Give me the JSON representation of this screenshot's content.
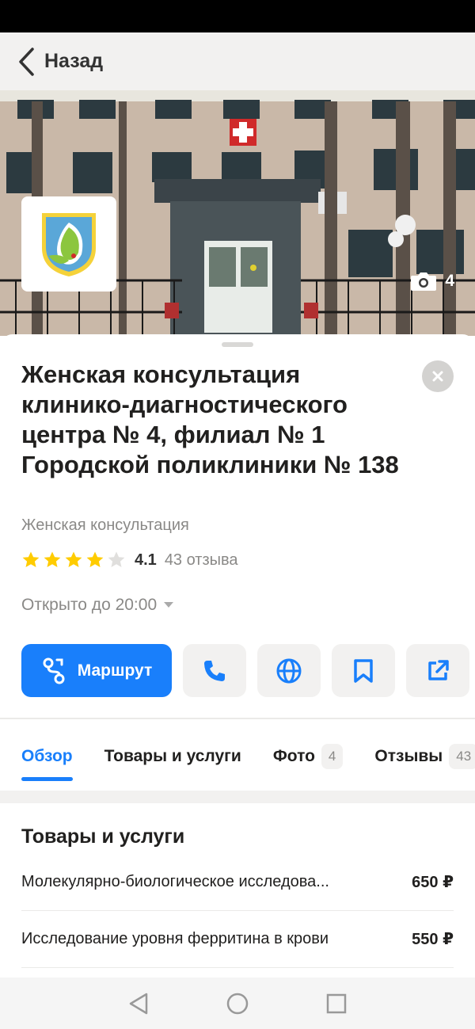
{
  "nav": {
    "back_label": "Назад"
  },
  "hero": {
    "photo_count": "4"
  },
  "organization": {
    "title": "Женская консультация клинико-диагностического центра № 4, филиал № 1 Городской поликлиники № 138",
    "category": "Женская консультация",
    "rating": 4.1,
    "rating_text": "4.1",
    "reviews_text": "43 отзыва",
    "hours_text": "Открыто до 20:00"
  },
  "actions": {
    "route_label": "Маршрут",
    "icons": [
      "phone-icon",
      "globe-icon",
      "bookmark-icon",
      "share-icon"
    ]
  },
  "tabs": [
    {
      "label": "Обзор",
      "active": true
    },
    {
      "label": "Товары и услуги"
    },
    {
      "label": "Фото",
      "badge": "4"
    },
    {
      "label": "Отзывы",
      "badge": "43"
    }
  ],
  "services": {
    "title": "Товары и услуги",
    "items": [
      {
        "name": "Молекулярно-биологическое исследова...",
        "price": "650 ₽"
      },
      {
        "name": "Исследование уровня ферритина в крови",
        "price": "550 ₽"
      }
    ]
  },
  "colors": {
    "accent": "#197ffb",
    "star": "#ffcc00",
    "muted": "#8a8987"
  }
}
